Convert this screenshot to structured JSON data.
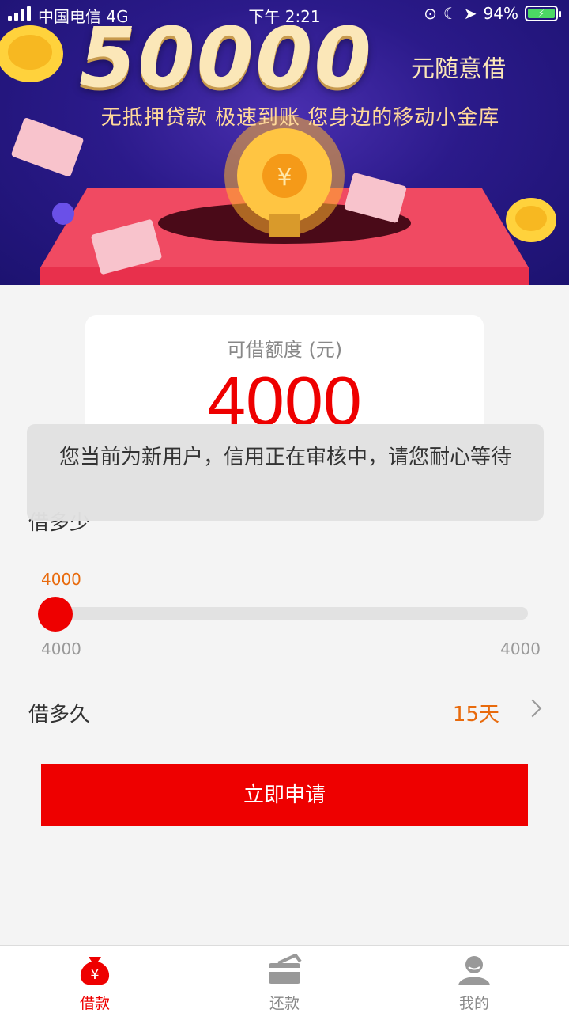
{
  "status_bar": {
    "carrier": "中国电信 4G",
    "time": "下午 2:21",
    "battery": "94%"
  },
  "banner": {
    "headline_amount": "50000",
    "headline_suffix": "元随意借",
    "tagline": "无抵押贷款 极速到账 您身边的移动小金库"
  },
  "card": {
    "label": "可借额度 (元)",
    "value": "4000"
  },
  "loan": {
    "amount_title": "借多少",
    "slider": {
      "current": "4000",
      "min": "4000",
      "max": "4000",
      "fraction": 0
    },
    "duration_label": "借多久",
    "duration_value": "15天",
    "apply_label": "立即申请"
  },
  "toast": {
    "message": "您当前为新用户，信用正在审核中，请您耐心等待"
  },
  "tabbar": {
    "items": [
      {
        "label": "借款",
        "icon": "money-bag-icon",
        "active": true
      },
      {
        "label": "还款",
        "icon": "card-icon",
        "active": false
      },
      {
        "label": "我的",
        "icon": "user-icon",
        "active": false
      }
    ]
  },
  "colors": {
    "accent": "#e00000",
    "highlight": "#e86a0c",
    "banner_bg": "#2b1a8a"
  }
}
